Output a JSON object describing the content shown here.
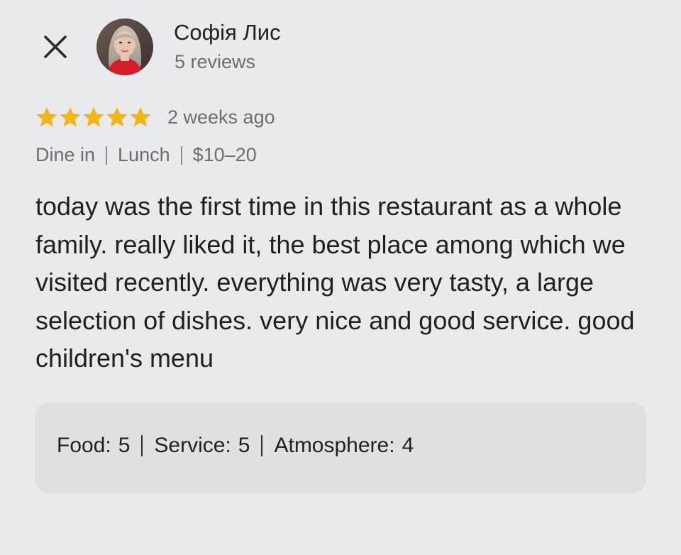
{
  "author": {
    "name": "Софія Лис",
    "reviews_count": "5 reviews"
  },
  "review": {
    "stars": 5,
    "star_color": "#f2b519",
    "date": "2 weeks ago",
    "tags": [
      "Dine in",
      "Lunch",
      "$10–20"
    ],
    "text": "today was the first time in this restaurant as a whole family. really liked it, the best place among which we visited recently. everything was very tasty, a large selection of dishes. very nice and good service. good children's menu"
  },
  "ratings": {
    "food_label": "Food:",
    "food_value": "5",
    "service_label": "Service:",
    "service_value": "5",
    "atmosphere_label": "Atmosphere:",
    "atmosphere_value": "4"
  },
  "icons": {
    "close": "close-icon",
    "star": "star-icon"
  }
}
